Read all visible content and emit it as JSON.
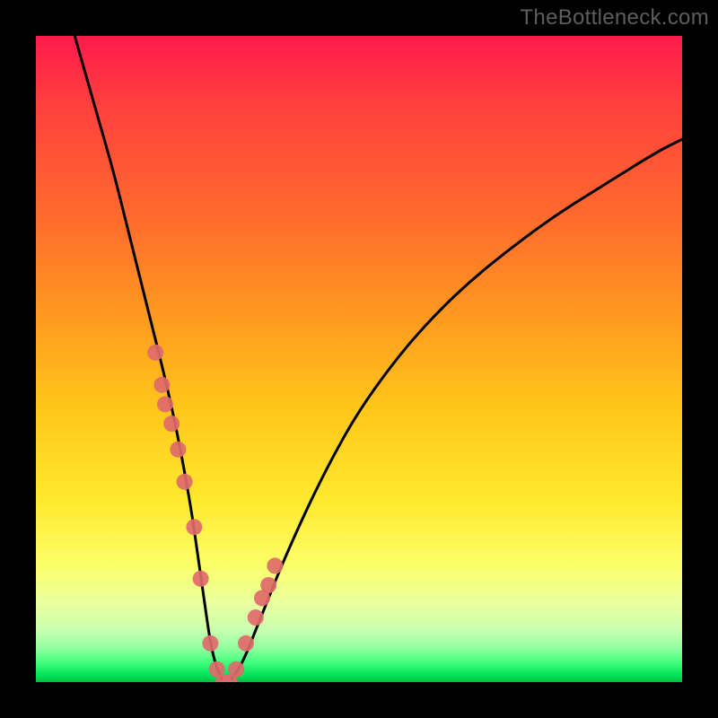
{
  "watermark": "TheBottleneck.com",
  "chart_data": {
    "type": "line",
    "title": "",
    "xlabel": "",
    "ylabel": "",
    "xlim": [
      0,
      100
    ],
    "ylim": [
      0,
      100
    ],
    "grid": false,
    "legend": false,
    "series": [
      {
        "name": "bottleneck-curve",
        "color": "#000000",
        "x": [
          6,
          8,
          10,
          12,
          14,
          16,
          18,
          20,
          22,
          24,
          25,
          26,
          27,
          28,
          29,
          30,
          32,
          34,
          36,
          38,
          42,
          46,
          50,
          55,
          60,
          66,
          72,
          80,
          88,
          96,
          100
        ],
        "y": [
          100,
          93,
          86,
          79,
          71,
          63,
          55,
          47,
          38,
          27,
          20,
          13,
          6,
          2,
          0,
          0,
          3,
          8,
          13,
          18,
          27,
          35,
          42,
          49,
          55,
          61,
          66,
          72,
          77,
          82,
          84
        ]
      }
    ],
    "markers": [
      {
        "name": "curve-points",
        "color": "#e06a6a",
        "x": [
          18.5,
          19.5,
          20.0,
          21.0,
          22.0,
          23.0,
          24.5,
          25.5,
          27.0,
          28.0,
          29.0,
          30.0,
          31.0,
          32.5,
          34.0,
          35.0,
          36.0,
          37.0
        ],
        "y": [
          51,
          46,
          43,
          40,
          36,
          31,
          24,
          16,
          6,
          2,
          0,
          0,
          2,
          6,
          10,
          13,
          15,
          18
        ]
      }
    ],
    "background_gradient": {
      "direction": "vertical",
      "stops": [
        {
          "pos": 0.0,
          "color": "#ff1a4d"
        },
        {
          "pos": 0.28,
          "color": "#ff6a2d"
        },
        {
          "pos": 0.58,
          "color": "#ffc71a"
        },
        {
          "pos": 0.82,
          "color": "#fbff6a"
        },
        {
          "pos": 0.95,
          "color": "#8bff9d"
        },
        {
          "pos": 1.0,
          "color": "#00c040"
        }
      ]
    }
  }
}
